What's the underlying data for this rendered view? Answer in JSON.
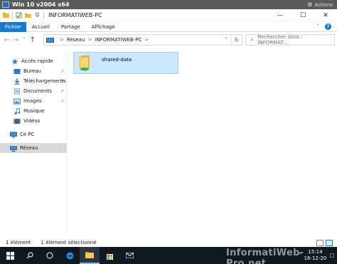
{
  "vm": {
    "title": "Win 10 v2004 x64",
    "actions_label": "Actions"
  },
  "window": {
    "title": "INFORMATIWEB-PC",
    "controls": {
      "minimize": "—",
      "maximize": "☐",
      "close": "✕"
    }
  },
  "ribbon": {
    "tabs": [
      "Fichier",
      "Accueil",
      "Partage",
      "Affichage"
    ],
    "expand_glyph": "˅",
    "help_glyph": "?"
  },
  "address": {
    "back": "←",
    "forward": "→",
    "recent": "˅",
    "up": "↑",
    "breadcrumb": [
      "Réseau",
      "INFORMATIWEB-PC"
    ],
    "separator": ">",
    "dropdown": "˅",
    "refresh": "↻"
  },
  "search": {
    "placeholder": "Rechercher dans : INFORMAT..."
  },
  "sidebar": {
    "items": [
      {
        "label": "Accès rapide",
        "icon": "star-icon",
        "pinned": false
      },
      {
        "label": "Bureau",
        "icon": "desktop-icon",
        "pinned": true
      },
      {
        "label": "Téléchargements",
        "icon": "download-icon",
        "pinned": true
      },
      {
        "label": "Documents",
        "icon": "documents-icon",
        "pinned": true
      },
      {
        "label": "Images",
        "icon": "images-icon",
        "pinned": true
      },
      {
        "label": "Musique",
        "icon": "music-icon",
        "pinned": false
      },
      {
        "label": "Vidéos",
        "icon": "videos-icon",
        "pinned": false
      },
      {
        "label": "Ce PC",
        "icon": "computer-icon",
        "pinned": false
      },
      {
        "label": "Réseau",
        "icon": "network-icon",
        "pinned": false,
        "selected": true
      }
    ],
    "pin_glyph": "↗"
  },
  "content": {
    "items": [
      {
        "name": "shared-data",
        "icon": "shared-folder-icon",
        "selected": true
      }
    ]
  },
  "status": {
    "count": "1 élément",
    "selection": "1 élément sélectionné"
  },
  "taskbar": {
    "clock_time": "15:14",
    "clock_date": "16-12-20",
    "chevron": "˄"
  },
  "watermark": "InformatiWeb-Pro.net",
  "colors": {
    "accent": "#1979ca",
    "selection_bg": "#cce8ff",
    "selection_border": "#99d1ff",
    "taskbar": "#101820",
    "vm_bar": "#5a5a5a"
  }
}
